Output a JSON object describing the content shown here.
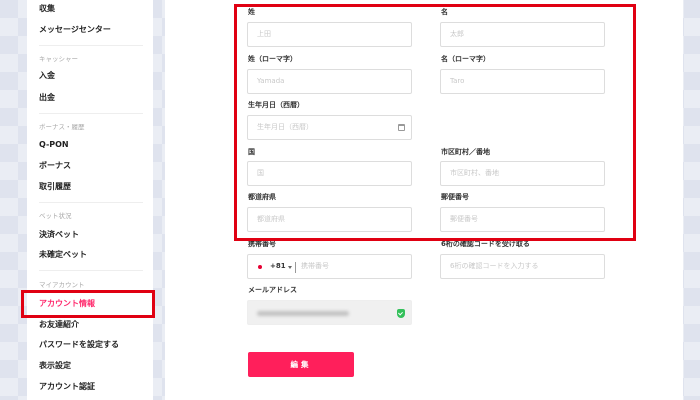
{
  "sidebar": {
    "top_items": [
      "収集",
      "メッセージセンター"
    ],
    "sections": [
      {
        "title": "キャッシャー",
        "items": [
          "入金",
          "出金"
        ]
      },
      {
        "title": "ボーナス・履歴",
        "items": [
          "Q-PON",
          "ボーナス",
          "取引履歴"
        ]
      },
      {
        "title": "ベット状況",
        "items": [
          "決済ベット",
          "未確定ベット"
        ]
      },
      {
        "title": "マイアカウント",
        "items": [
          "アカウント情報",
          "お友達紹介",
          "パスワードを設定する",
          "表示設定",
          "アカウント認証"
        ]
      }
    ],
    "active_item": "アカウント情報"
  },
  "form": {
    "last_name": {
      "label": "姓",
      "placeholder": "上田"
    },
    "first_name": {
      "label": "名",
      "placeholder": "太郎"
    },
    "last_name_roman": {
      "label": "姓（ローマ字）",
      "placeholder": "Yamada"
    },
    "first_name_roman": {
      "label": "名（ローマ字）",
      "placeholder": "Taro"
    },
    "birthdate": {
      "label": "生年月日（西暦）",
      "placeholder": "生年月日（西暦）"
    },
    "country": {
      "label": "国",
      "placeholder": "国"
    },
    "city": {
      "label": "市区町村／番地",
      "placeholder": "市区町村、番地"
    },
    "prefecture": {
      "label": "都道府県",
      "placeholder": "都道府県"
    },
    "postal_code": {
      "label": "郵便番号",
      "placeholder": "郵便番号"
    },
    "phone": {
      "label": "携帯番号",
      "country_code": "+81",
      "placeholder": "携帯番号"
    },
    "verification": {
      "label": "6桁の確認コードを受け取る",
      "placeholder": "6桁の確認コードを入力する"
    },
    "email": {
      "label": "メールアドレス"
    },
    "submit_label": "編集"
  },
  "colors": {
    "highlight": "#e00012",
    "accent": "#ff1f5b",
    "verified": "#33c05a"
  },
  "icons": {
    "calendar": "calendar-icon",
    "verified": "shield-check-icon",
    "phone_flag": "japan-flag-icon"
  }
}
